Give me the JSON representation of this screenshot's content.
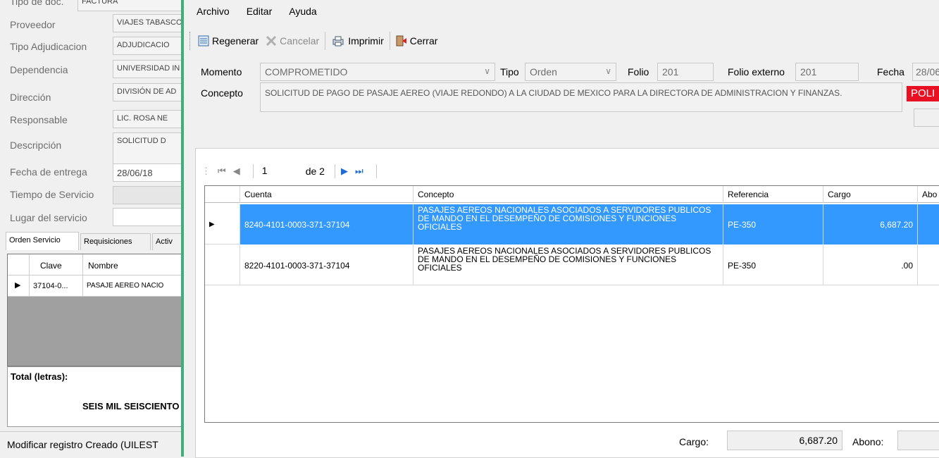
{
  "background_window": {
    "top_partial_label": "Tipo de doc.",
    "top_partial_value": "FACTURA",
    "fields": [
      {
        "label": "Proveedor",
        "value": "VIAJES TABASCO"
      },
      {
        "label": "Tipo Adjudicacion",
        "value": "ADJUDICACIO"
      },
      {
        "label": "Dependencia",
        "value": "UNIVERSIDAD IN"
      },
      {
        "label": "Dirección",
        "value": "DIVISIÓN DE AD"
      },
      {
        "label": "Responsable",
        "value": "LIC. ROSA NE"
      },
      {
        "label": "Descripción",
        "value": "SOLICITUD D"
      },
      {
        "label": "Fecha de entrega",
        "value": "28/06/18"
      },
      {
        "label": "Tiempo de Servicio",
        "value": ""
      },
      {
        "label": "Lugar del servicio",
        "value": ""
      }
    ],
    "tabs": [
      "Orden Servicio",
      "Requisiciones",
      "Activ"
    ],
    "grid": {
      "headers": [
        "Clave",
        "Nombre"
      ],
      "row": [
        "37104-0...",
        "PASAJE AEREO NACIO"
      ]
    },
    "total_label": "Total (letras):",
    "total_value": "SEIS MIL SEISCIENTO",
    "status": "Modificar registro   Creado (UILEST"
  },
  "window": {
    "menu": [
      "Archivo",
      "Editar",
      "Ayuda"
    ],
    "toolbar": {
      "regenerar": "Regenerar",
      "cancelar": "Cancelar",
      "imprimir": "Imprimir",
      "cerrar": "Cerrar"
    },
    "form": {
      "momento_label": "Momento",
      "momento_value": "COMPROMETIDO",
      "tipo_label": "Tipo",
      "tipo_value": "Orden",
      "folio_label": "Folio",
      "folio_value": "201",
      "folio_externo_label": "Folio externo",
      "folio_externo_value": "201",
      "fecha_label": "Fecha",
      "fecha_value": "28/06",
      "concepto_label": "Concepto",
      "concepto_value": "SOLICITUD DE PAGO DE PASAJE AEREO (VIAJE REDONDO)   A LA CIUDAD DE MEXICO PARA LA DIRECTORA DE ADMINISTRACION Y FINANZAS.",
      "poli_badge": "POLI"
    },
    "pager": {
      "current": "1",
      "of_text": "de 2"
    },
    "grid": {
      "headers": [
        "Cuenta",
        "Concepto",
        "Referencia",
        "Cargo",
        "Abo"
      ],
      "rows": [
        {
          "cuenta": "8240-4101-0003-371-37104",
          "concepto": "PASAJES AEREOS NACIONALES ASOCIADOS A SERVIDORES PUBLICOS DE MANDO EN EL DESEMPEÑO DE COMISIONES Y FUNCIONES OFICIALES",
          "referencia": "PE-350",
          "cargo": "6,687.20",
          "abono": ""
        },
        {
          "cuenta": "8220-4101-0003-371-37104",
          "concepto": "PASAJES AEREOS NACIONALES ASOCIADOS A SERVIDORES PUBLICOS DE MANDO EN EL DESEMPEÑO DE COMISIONES Y FUNCIONES OFICIALES",
          "referencia": "PE-350",
          "cargo": ".00",
          "abono": ""
        }
      ]
    },
    "totals": {
      "cargo_label": "Cargo:",
      "cargo_value": "6,687.20",
      "abono_label": "Abono:",
      "abono_value": ""
    }
  },
  "colors": {
    "selection": "#3399ff",
    "window_border": "#3fae7a",
    "poli_badge": "#e81123"
  }
}
